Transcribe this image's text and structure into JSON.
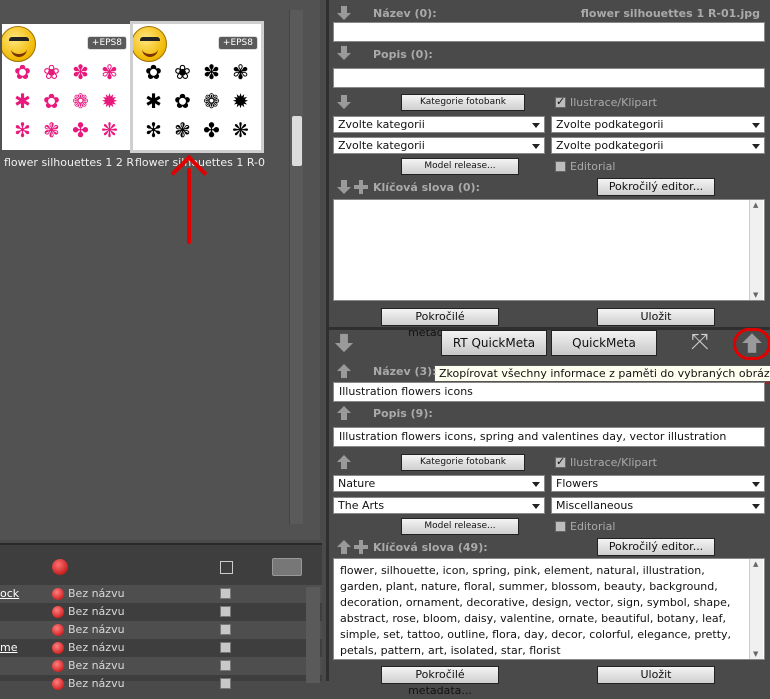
{
  "thumbnails": [
    {
      "badge": "+EPS8",
      "caption": "flower silhouettes 1 2 R-"
    },
    {
      "badge": "+EPS8",
      "caption": "flower silhouettes 1 R-0"
    }
  ],
  "list": {
    "rows": [
      {
        "link": "ock",
        "name": "Bez názvu"
      },
      {
        "link": "",
        "name": "Bez názvu"
      },
      {
        "link": "",
        "name": "Bez názvu"
      },
      {
        "link": "me",
        "name": "Bez názvu"
      },
      {
        "link": "",
        "name": "Bez názvu"
      },
      {
        "link": "",
        "name": "Bez názvu"
      }
    ]
  },
  "top_form": {
    "nazev_label": "Název (0):",
    "filename": "flower silhouettes 1 R-01.jpg",
    "nazev_value": "",
    "popis_label": "Popis (0):",
    "popis_value": "",
    "kategorie_btn": "Kategorie fotobank",
    "ilustrace_label": "Ilustrace/Klipart",
    "cat1": "Zvolte kategorii",
    "subcat1": "Zvolte podkategorii",
    "cat2": "Zvolte kategorii",
    "subcat2": "Zvolte podkategorii",
    "model_btn": "Model release...",
    "editorial_label": "Editorial",
    "klicova_label": "Klíčová slova (0):",
    "pokrocily_editor_btn": "Pokročilý editor...",
    "keywords": "",
    "pokrocile_metadata_btn": "Pokročilé metadata...",
    "ulozit_btn": "Uložit"
  },
  "toolbar": {
    "rt_quickmeta": "RT QuickMeta",
    "quickmeta": "QuickMeta",
    "tooltip": "Zkopírovat všechny informace z paměti do vybraných obrázků"
  },
  "bottom_form": {
    "nazev_label": "Název (3):",
    "nazev_value": "Illustration flowers icons",
    "popis_label": "Popis (9):",
    "popis_value": "Illustration flowers icons, spring and valentines day, vector illustration",
    "kategorie_btn": "Kategorie fotobank",
    "ilustrace_label": "Ilustrace/Klipart",
    "cat1": "Nature",
    "subcat1": "Flowers",
    "cat2": "The Arts",
    "subcat2": "Miscellaneous",
    "model_btn": "Model release...",
    "editorial_label": "Editorial",
    "klicova_label": "Klíčová slova (49):",
    "pokrocily_editor_btn": "Pokročilý editor...",
    "keywords": "flower, silhouette, icon, spring, pink, element, natural, illustration, garden, plant, nature, floral, summer, blossom, beauty, background, decoration, ornament, decorative, design, vector, sign, symbol, shape, abstract, rose, bloom, daisy, valentine, ornate, beautiful, botany, leaf, simple, set, tattoo, outline, flora, day, decor, colorful, elegance, pretty, petals, pattern, art, isolated, star, florist",
    "pokrocile_metadata_btn": "Pokročilé metadata...",
    "ulozit_btn": "Uložit"
  },
  "colors": {
    "annotation_red": "#e00000",
    "panel_bg": "#4a4a4a"
  }
}
